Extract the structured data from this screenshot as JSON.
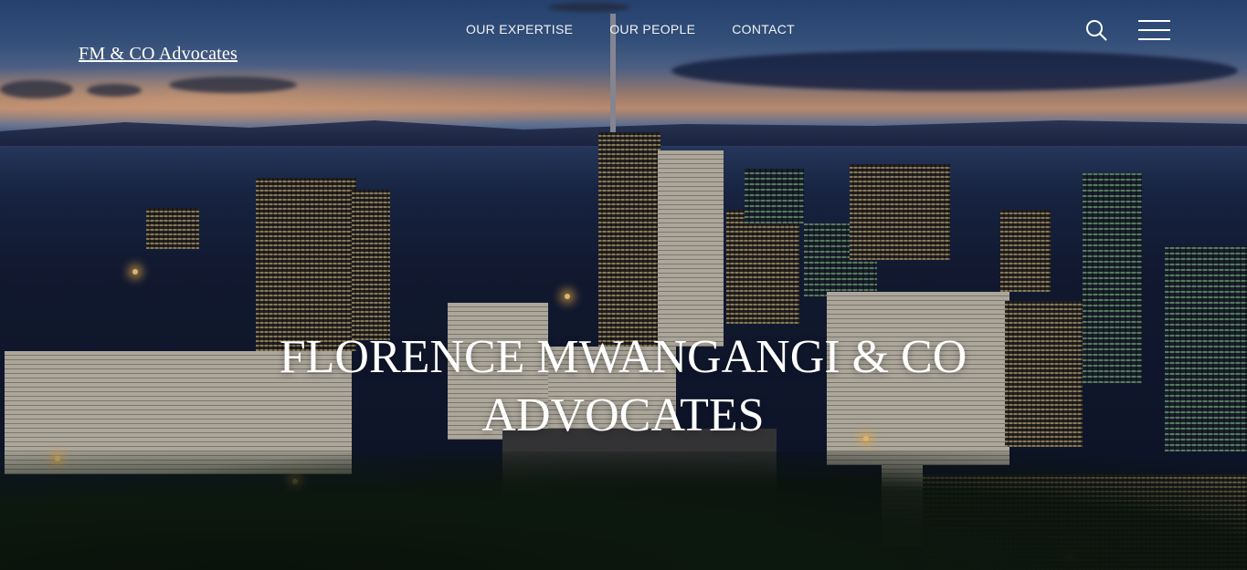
{
  "brand": {
    "name": "FM & CO Advocates"
  },
  "nav": {
    "items": [
      "OUR EXPERTISE",
      "OUR PEOPLE",
      "CONTACT"
    ]
  },
  "header_icons": [
    "search-icon",
    "hamburger-menu-icon"
  ],
  "hero": {
    "title": "FLORENCE MWANGANGI & CO ADVOCATES"
  },
  "colors": {
    "text": "#ffffff",
    "sky_top": "#2b4a7c",
    "sunset": "#d7a07e"
  }
}
